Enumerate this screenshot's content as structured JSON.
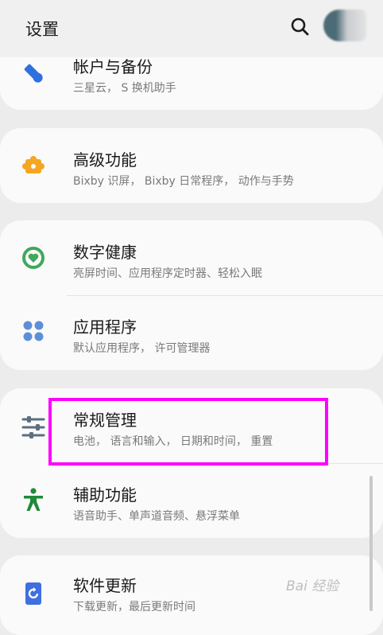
{
  "header": {
    "title": "设置",
    "search_icon": "search-icon"
  },
  "items": [
    {
      "id": "accounts",
      "title": "帐户与备份",
      "subtitle": "三星云， S 换机助手",
      "icon": "key-icon",
      "color": "#2f6fe0"
    },
    {
      "id": "advanced",
      "title": "高级功能",
      "subtitle": "Bixby 识屏， Bixby 日常程序， 动作与手势",
      "icon": "puzzle-icon",
      "color": "#f5a623"
    },
    {
      "id": "digital",
      "title": "数字健康",
      "subtitle": "亮屏时间、应用程序定时器、轻松入眠",
      "icon": "heart-ring-icon",
      "color": "#3fa85c"
    },
    {
      "id": "apps",
      "title": "应用程序",
      "subtitle": "默认应用程序， 许可管理器",
      "icon": "apps-grid-icon",
      "color": "#5c8fd8"
    },
    {
      "id": "general",
      "title": "常规管理",
      "subtitle": "电池， 语言和输入， 日期和时间， 重置",
      "icon": "sliders-icon",
      "color": "#5a6f80"
    },
    {
      "id": "accessibility",
      "title": "辅助功能",
      "subtitle": "语音助手、单声道音频、悬浮菜单",
      "icon": "accessibility-icon",
      "color": "#1f8a3a"
    },
    {
      "id": "update",
      "title": "软件更新",
      "subtitle": "下载更新，最后更新时间",
      "icon": "update-icon",
      "color": "#3f6fe0"
    }
  ],
  "watermark": "Bai 经验"
}
